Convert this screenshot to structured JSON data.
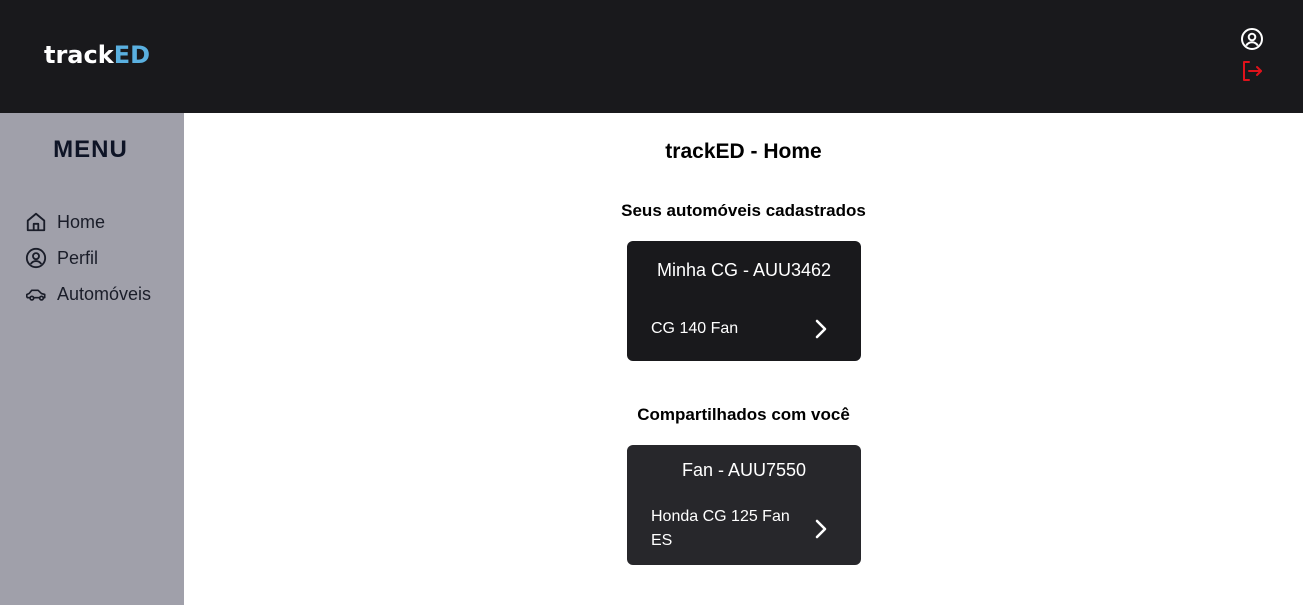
{
  "header": {
    "logo_part1": "track",
    "logo_part2": "ED",
    "icons": [
      "user-circle-icon",
      "logout-icon"
    ],
    "logout_color": "#e0121b",
    "logo_accent_color": "#5ab0e0"
  },
  "sidebar": {
    "title": "MENU",
    "items": [
      {
        "label": "Home",
        "icon": "home-icon"
      },
      {
        "label": "Perfil",
        "icon": "user-circle-icon"
      },
      {
        "label": "Automóveis",
        "icon": "car-icon"
      }
    ]
  },
  "main": {
    "title": "trackED - Home",
    "owned_section_title": "Seus automóveis cadastrados",
    "owned": [
      {
        "title": "Minha CG - AUU3462",
        "model": "CG 140 Fan"
      }
    ],
    "shared_section_title": "Compartilhados com você",
    "shared": [
      {
        "title": "Fan - AUU7550",
        "model": "Honda CG 125 Fan ES"
      }
    ]
  }
}
